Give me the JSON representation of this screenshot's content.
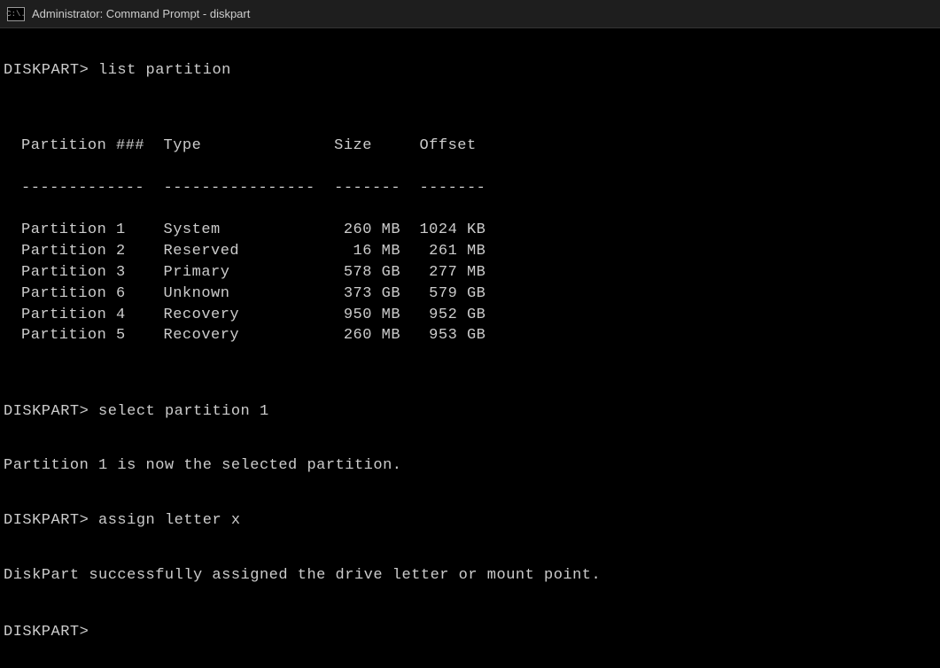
{
  "titlebar": {
    "icon_text": "C:\\.",
    "title": "Administrator: Command Prompt - diskpart"
  },
  "session": {
    "prompt": "DISKPART>",
    "commands": {
      "c1": "list partition",
      "c2": "select partition 1",
      "c3": "assign letter x",
      "c4": ""
    },
    "outputs": {
      "o2": "Partition 1 is now the selected partition.",
      "o3": "DiskPart successfully assigned the drive letter or mount point."
    },
    "table": {
      "header": {
        "col1": "Partition ###",
        "col2": "Type",
        "col3": "Size",
        "col4": "Offset"
      },
      "divider": {
        "col1": "-------------",
        "col2": "----------------",
        "col3": "-------",
        "col4": "-------"
      },
      "rows": [
        {
          "col1": "Partition 1",
          "col2": "System",
          "col3": "260 MB",
          "col4": "1024 KB"
        },
        {
          "col1": "Partition 2",
          "col2": "Reserved",
          "col3": "16 MB",
          "col4": "261 MB"
        },
        {
          "col1": "Partition 3",
          "col2": "Primary",
          "col3": "578 GB",
          "col4": "277 MB"
        },
        {
          "col1": "Partition 6",
          "col2": "Unknown",
          "col3": "373 GB",
          "col4": "579 GB"
        },
        {
          "col1": "Partition 4",
          "col2": "Recovery",
          "col3": "950 MB",
          "col4": "952 GB"
        },
        {
          "col1": "Partition 5",
          "col2": "Recovery",
          "col3": "260 MB",
          "col4": "953 GB"
        }
      ]
    }
  }
}
